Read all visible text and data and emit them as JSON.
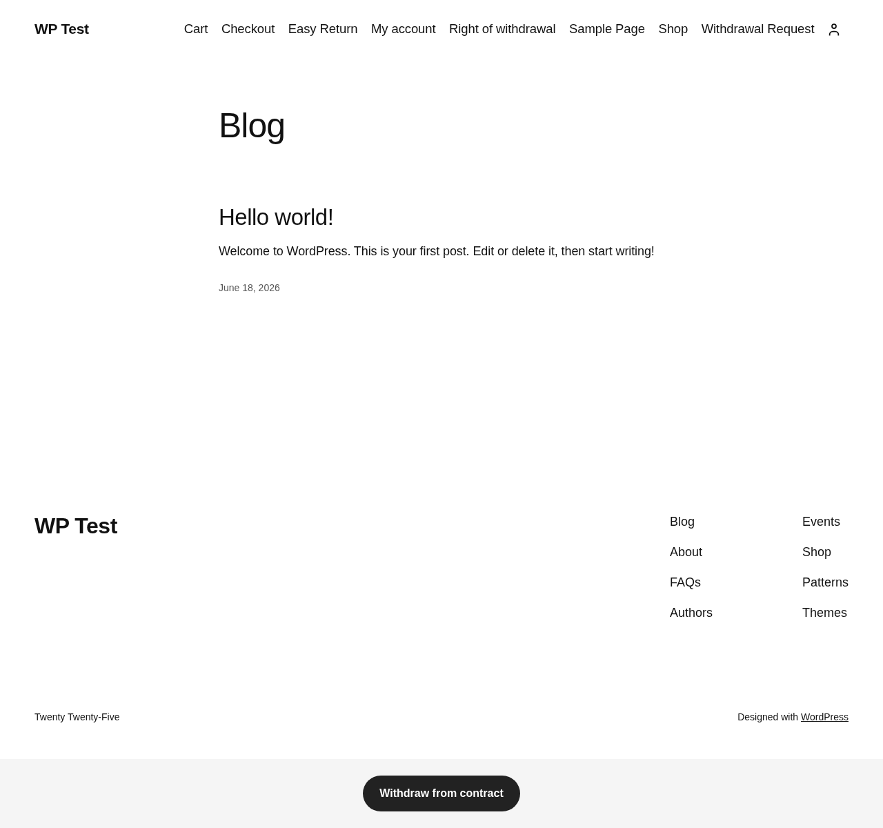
{
  "header": {
    "site_title": "WP Test",
    "nav": [
      "Cart",
      "Checkout",
      "Easy Return",
      "My account",
      "Right of withdrawal",
      "Sample Page",
      "Shop",
      "Withdrawal Request"
    ]
  },
  "main": {
    "heading": "Blog",
    "posts": [
      {
        "title": "Hello world!",
        "excerpt": "Welcome to WordPress. This is your first post. Edit or delete it, then start writing!",
        "date": "June 18, 2026"
      }
    ]
  },
  "footer": {
    "site_title": "WP Test",
    "link_columns": [
      [
        "Blog",
        "About",
        "FAQs",
        "Authors"
      ],
      [
        "Events",
        "Shop",
        "Patterns",
        "Themes"
      ]
    ],
    "theme_credit": "Twenty Twenty-Five",
    "credit": {
      "text": "Designed with",
      "link": "WordPress"
    }
  },
  "withdraw_bar": {
    "button": "Withdraw from contract"
  }
}
